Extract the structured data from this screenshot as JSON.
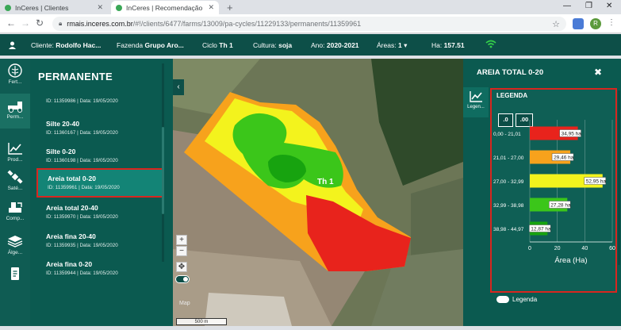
{
  "browser": {
    "tabs": [
      {
        "title": "InCeres | Clientes",
        "active": false,
        "fav_color": "#3aa757"
      },
      {
        "title": "InCeres | Recomendação",
        "active": true,
        "fav_color": "#3aa757"
      }
    ],
    "url_host": "rmais.inceres.com.br",
    "url_path": "/#!/clients/6477/farms/13009/pa-cycles/11229133/permanents/11359961",
    "profile_initial": "R"
  },
  "header": {
    "client_label": "Cliente:",
    "client_value": "Rodolfo Hac...",
    "farm_label": "Fazenda",
    "farm_value": "Grupo Aro...",
    "cycle_label": "Ciclo",
    "cycle_value": "Th 1",
    "crop_label": "Cultura:",
    "crop_value": "soja",
    "year_label": "Ano:",
    "year_value": "2020-2021",
    "areas_label": "Áreas:",
    "areas_value": "1",
    "ha_label": "Ha:",
    "ha_value": "157.51"
  },
  "rail": [
    {
      "label": "Fert...",
      "icon": "fertility-icon"
    },
    {
      "label": "Perm...",
      "icon": "permanent-icon"
    },
    {
      "label": "Prod...",
      "icon": "productivity-chart-icon"
    },
    {
      "label": "Saté...",
      "icon": "satellite-icon"
    },
    {
      "label": "Comp...",
      "icon": "compare-icon"
    },
    {
      "label": "Álge...",
      "icon": "layers-icon"
    },
    {
      "label": "",
      "icon": "report-icon"
    }
  ],
  "panel": {
    "title": "PERMANENTE",
    "items": [
      {
        "name": "",
        "sub": "ID: 11359986 | Data: 19/05/2020"
      },
      {
        "name": "Silte 20-40",
        "sub": "ID: 11360167 | Data: 19/05/2020"
      },
      {
        "name": "Silte 0-20",
        "sub": "ID: 11360198 | Data: 19/05/2020"
      },
      {
        "name": "Areia total 0-20",
        "sub": "ID: 11359961 | Data: 19/05/2020",
        "selected": true
      },
      {
        "name": "Areia total 20-40",
        "sub": "ID: 11359970 | Data: 19/05/2020"
      },
      {
        "name": "Areia fina 20-40",
        "sub": "ID: 11359935 | Data: 19/05/2020"
      },
      {
        "name": "Areia fina 0-20",
        "sub": "ID: 11359944 | Data: 19/05/2020"
      }
    ]
  },
  "map": {
    "field_label": "Th 1",
    "scale_label": "500 m",
    "google_label": "Map"
  },
  "right_panel": {
    "title": "AREIA TOTAL 0-20",
    "rail_label": "Legen...",
    "legend_title": "LEGENDA",
    "dec_buttons": [
      ".0",
      ".00"
    ],
    "toggle_label": "Legenda"
  },
  "chart_data": {
    "type": "bar",
    "orientation": "horizontal",
    "categories": [
      "0,00 - 21,01",
      "21,01 - 27,00",
      "27,00 - 32,99",
      "32,99 - 38,98",
      "38,98 - 44,97"
    ],
    "values": [
      34.95,
      29.46,
      52.95,
      27.28,
      12.87
    ],
    "value_labels": [
      "34,95 ha",
      "29,46 ha",
      "52,95 ha",
      "27,28 ha",
      "12,87 ha"
    ],
    "colors": [
      "#e8231c",
      "#f7a21c",
      "#f3f31d",
      "#3bc61a",
      "#17a30f"
    ],
    "xlabel": "Área (Ha)",
    "ylabel": "",
    "xlim": [
      0,
      60
    ],
    "xticks": [
      "0",
      "20",
      "40",
      "60"
    ],
    "grid": true
  }
}
